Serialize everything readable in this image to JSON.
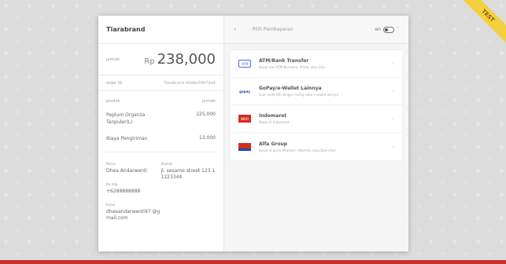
{
  "corner_ribbon": "TEST",
  "summary": {
    "merchant": "Tiarabrand",
    "total_label": "jumlah",
    "currency": "Rp",
    "total": "238,000",
    "order_label": "order ID",
    "order_id": "Tiarabrand.A0dbc59b7ba4",
    "items_header_product": "produk",
    "items_header_amount": "jumlah",
    "items": [
      {
        "name": "Peplum Organza Tanpuler(L)",
        "amount": "225,000"
      },
      {
        "name": "Biaya Pengiriman",
        "amount": "13,000"
      }
    ],
    "customer": {
      "name_label": "Nama",
      "name": "Dhea Andarwenti",
      "address_label": "Alamat",
      "address": "jl. sesame street 123 11223344",
      "phone_label": "No telp",
      "phone": "+6288888888",
      "email_label": "Email",
      "email": "dheaandarwenti97 @gmail.com"
    }
  },
  "payment": {
    "back_icon": "chevron-left-icon",
    "title": "Pilih Pembayaran",
    "lang_short": "en",
    "methods": [
      {
        "name": "ATM/Bank Transfer",
        "desc": "Bayar dari ATM Bersama, Prima, atau Alto",
        "icon": "atm-icon",
        "icon_text": "ATM"
      },
      {
        "name": "GoPay/e-Wallet Lainnya",
        "desc": "Scan kode QR dengan GoPay atau e-wallet lainnya",
        "icon": "gopay-icon",
        "icon_text": "gopay"
      },
      {
        "name": "Indomaret",
        "desc": "Bayar di Indomaret",
        "icon": "indomaret-icon",
        "icon_text": "INDO"
      },
      {
        "name": "Alfa Group",
        "desc": "Bayar di gerai Alfamart, Alfamidi, atau Dan+Dan",
        "icon": "alfa-icon",
        "icon_text": ""
      }
    ]
  }
}
